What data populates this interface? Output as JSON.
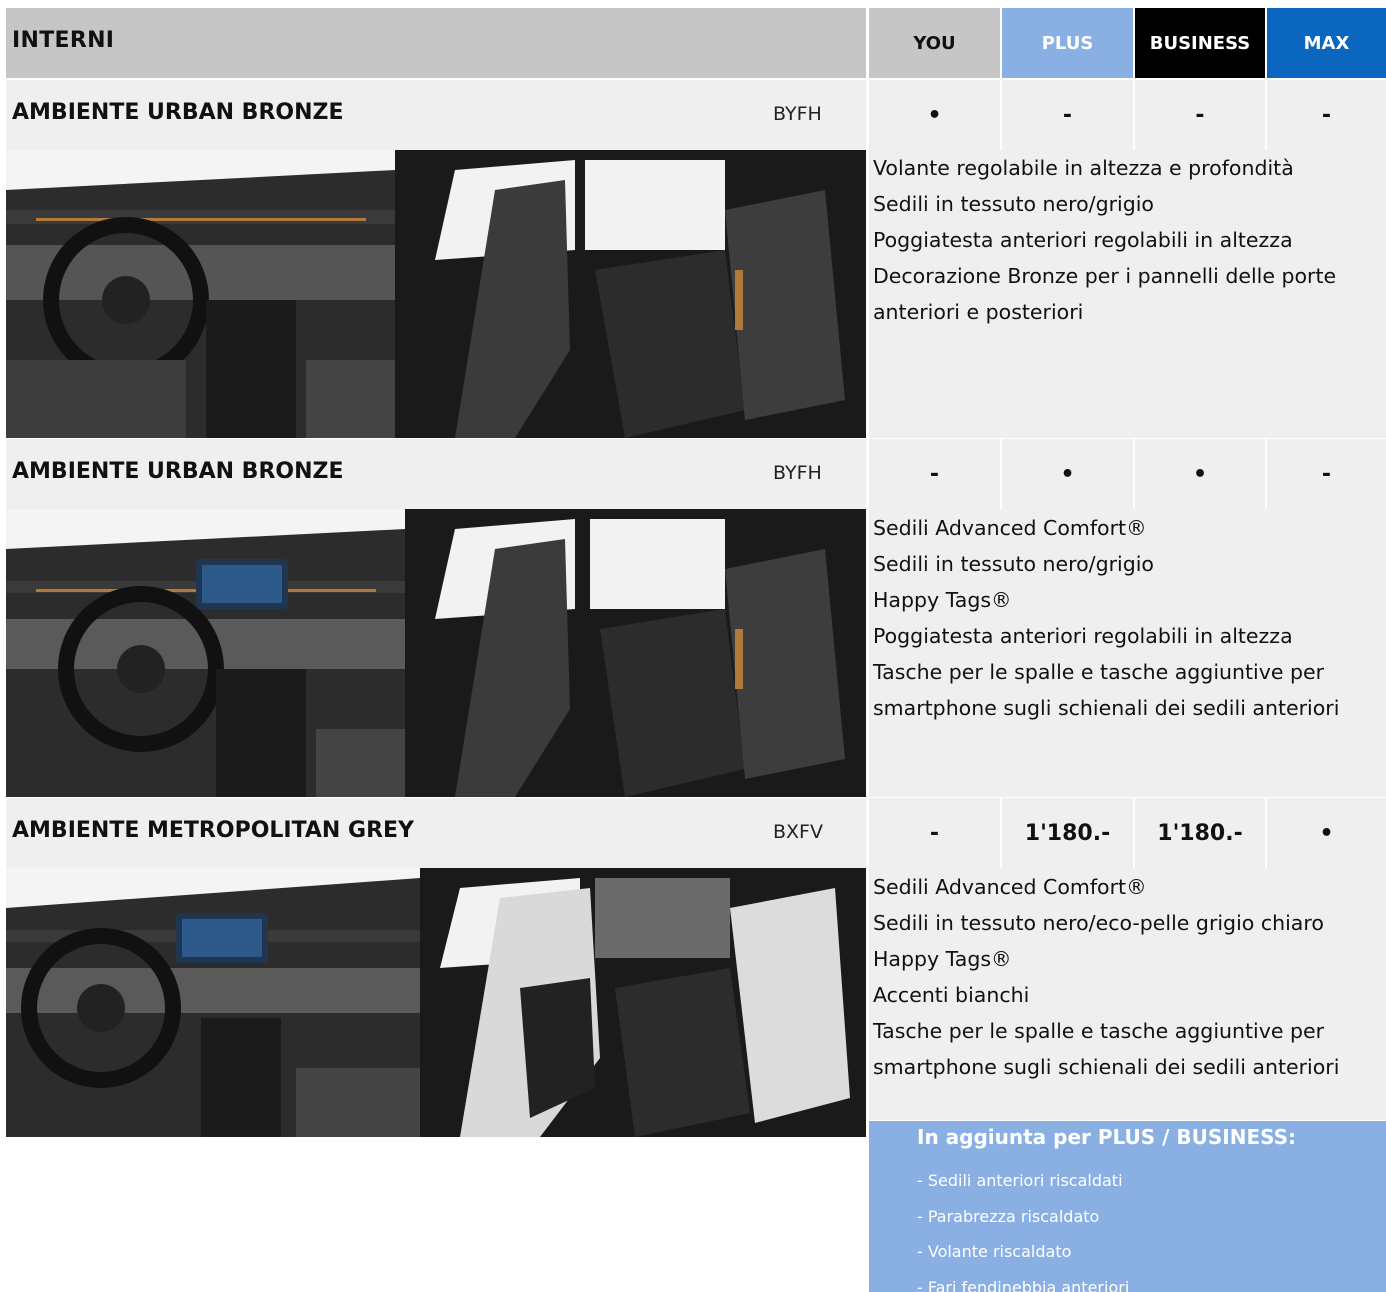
{
  "header": {
    "title": "INTERNI",
    "trims": [
      "YOU",
      "PLUS",
      "BUSINESS",
      "MAX"
    ]
  },
  "colors": {
    "header_gray": "#c6c6c6",
    "row_gray": "#efefef",
    "plus_blue": "#8ab0e3",
    "business_black": "#000000",
    "max_blue": "#0b66c0"
  },
  "ambients": [
    {
      "name": "AMBIENTE URBAN BRONZE",
      "code": "BYFH",
      "availability": [
        "•",
        "-",
        "-",
        "-"
      ],
      "features": [
        "Volante regolabile in altezza e profondità",
        "Sedili in tessuto nero/grigio",
        "Poggiatesta anteriori regolabili in altezza",
        "Decorazione Bronze per i pannelli delle porte",
        "anteriori e posteriori"
      ]
    },
    {
      "name": "AMBIENTE URBAN BRONZE",
      "code": "BYFH",
      "availability": [
        "-",
        "•",
        "•",
        "-"
      ],
      "features": [
        "Sedili Advanced Comfort®",
        "Sedili in tessuto nero/grigio",
        "Happy Tags®",
        "Poggiatesta anteriori regolabili in altezza",
        "Tasche per le spalle e tasche aggiuntive per",
        "smartphone sugli schienali dei sedili anteriori"
      ]
    },
    {
      "name": "AMBIENTE METROPOLITAN GREY",
      "code": "BXFV",
      "availability": [
        "-",
        "1'180.-",
        "1'180.-",
        "•"
      ],
      "features": [
        "Sedili Advanced Comfort®",
        "Sedili in tessuto nero/eco-pelle grigio chiaro",
        "Happy Tags®",
        "Accenti bianchi",
        "Tasche per le spalle e tasche aggiuntive per",
        "smartphone sugli schienali dei sedili anteriori"
      ]
    }
  ],
  "extras": {
    "title": "In aggiunta per PLUS / BUSINESS:",
    "items": [
      "- Sedili anteriori riscaldati",
      "- Parabrezza riscaldato",
      "- Volante riscaldato",
      "- Fari fendinebbia anteriori"
    ]
  }
}
